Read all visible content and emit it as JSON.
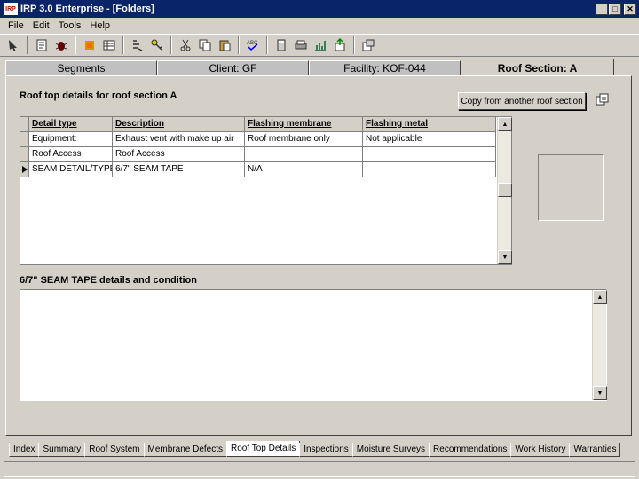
{
  "window": {
    "app_icon_text": "IRP",
    "title": "IRP 3.0 Enterprise - [Folders]",
    "minimize": "_",
    "restore": "□",
    "close": "✕"
  },
  "menu": [
    "File",
    "Edit",
    "Tools",
    "Help"
  ],
  "section_tabs": [
    {
      "label": "Segments"
    },
    {
      "label": "Client: GF"
    },
    {
      "label": "Facility: KOF-044"
    },
    {
      "label": "Roof Section: A"
    }
  ],
  "main": {
    "heading": "Roof top details for roof section A",
    "copy_button": "Copy from another roof section",
    "details_heading": "6/7\" SEAM TAPE details and condition",
    "details_value": ""
  },
  "grid": {
    "columns": [
      "Detail type",
      "Description",
      "Flashing membrane",
      "Flashing metal"
    ],
    "rows": [
      {
        "detail_type": "Equipment:",
        "description": "Exhaust vent with make up air",
        "flashing_membrane": "Roof membrane only",
        "flashing_metal": "Not applicable"
      },
      {
        "detail_type": "Roof Access",
        "description": "Roof Access",
        "flashing_membrane": "",
        "flashing_metal": ""
      },
      {
        "detail_type": "SEAM DETAIL/TYPE",
        "description": "6/7\" SEAM TAPE",
        "flashing_membrane": "N/A",
        "flashing_metal": ""
      }
    ],
    "selected_row": 2
  },
  "bottom_tabs": [
    "Index",
    "Summary",
    "Roof System",
    "Membrane Defects",
    "Roof Top Details",
    "Inspections",
    "Moisture Surveys",
    "Recommendations",
    "Work History",
    "Warranties"
  ],
  "active_bottom_tab": "Roof Top Details"
}
